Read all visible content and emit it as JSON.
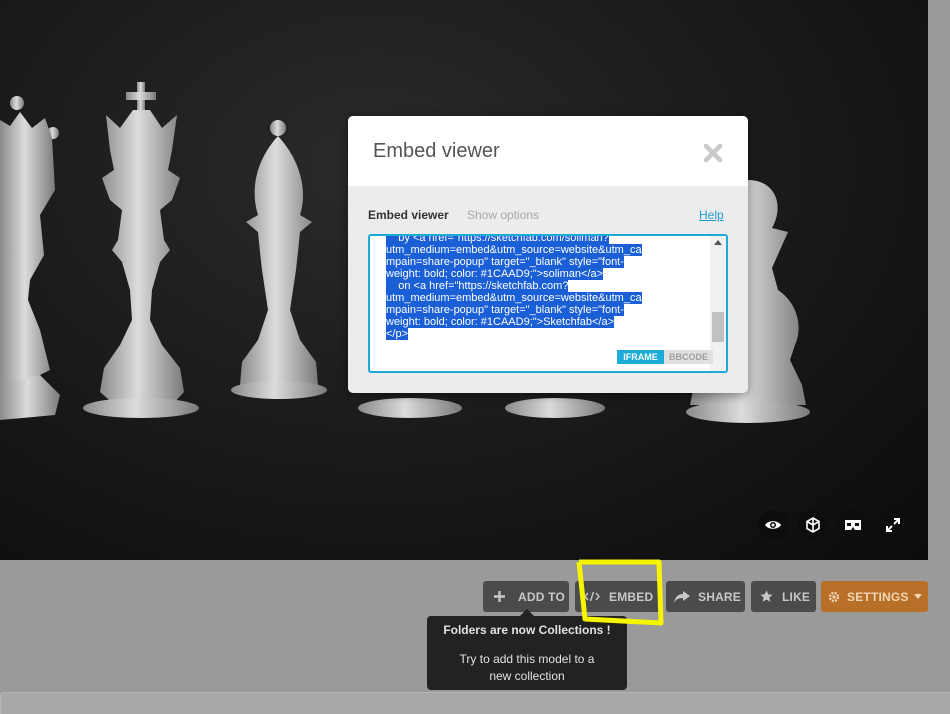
{
  "modal": {
    "title": "Embed viewer",
    "section_label": "Embed viewer",
    "show_options": "Show options",
    "help": "Help",
    "code_lines": [
      "    by <a href=\"https://sketchfab.com/soliman?",
      "utm_medium=embed&utm_source=website&utm_ca",
      "mpain=share-popup\" target=\"_blank\" style=\"font-",
      "weight: bold; color: #1CAAD9;\">soliman</a>",
      "    on <a href=\"https://sketchfab.com?",
      "utm_medium=embed&utm_source=website&utm_ca",
      "mpain=share-popup\" target=\"_blank\" style=\"font-",
      "weight: bold; color: #1CAAD9;\">Sketchfab</a>",
      "</p>"
    ],
    "tabs": {
      "iframe": "IFRAME",
      "bbcode": "BBCODE",
      "active": "IFRAME"
    }
  },
  "toolbar": {
    "add_to": "ADD TO",
    "embed": "EMBED",
    "share": "SHARE",
    "like": "LIKE",
    "settings": "SETTINGS"
  },
  "tooltip": {
    "title": "Folders are now Collections !",
    "body": "Try to add this model to a new collection"
  },
  "viewer_controls": [
    "eye-icon",
    "cube-icon",
    "vr-icon",
    "fullscreen-icon"
  ],
  "colors": {
    "accent": "#1CAAD9",
    "settings": "#B86F27",
    "highlight": "#F5F500"
  }
}
